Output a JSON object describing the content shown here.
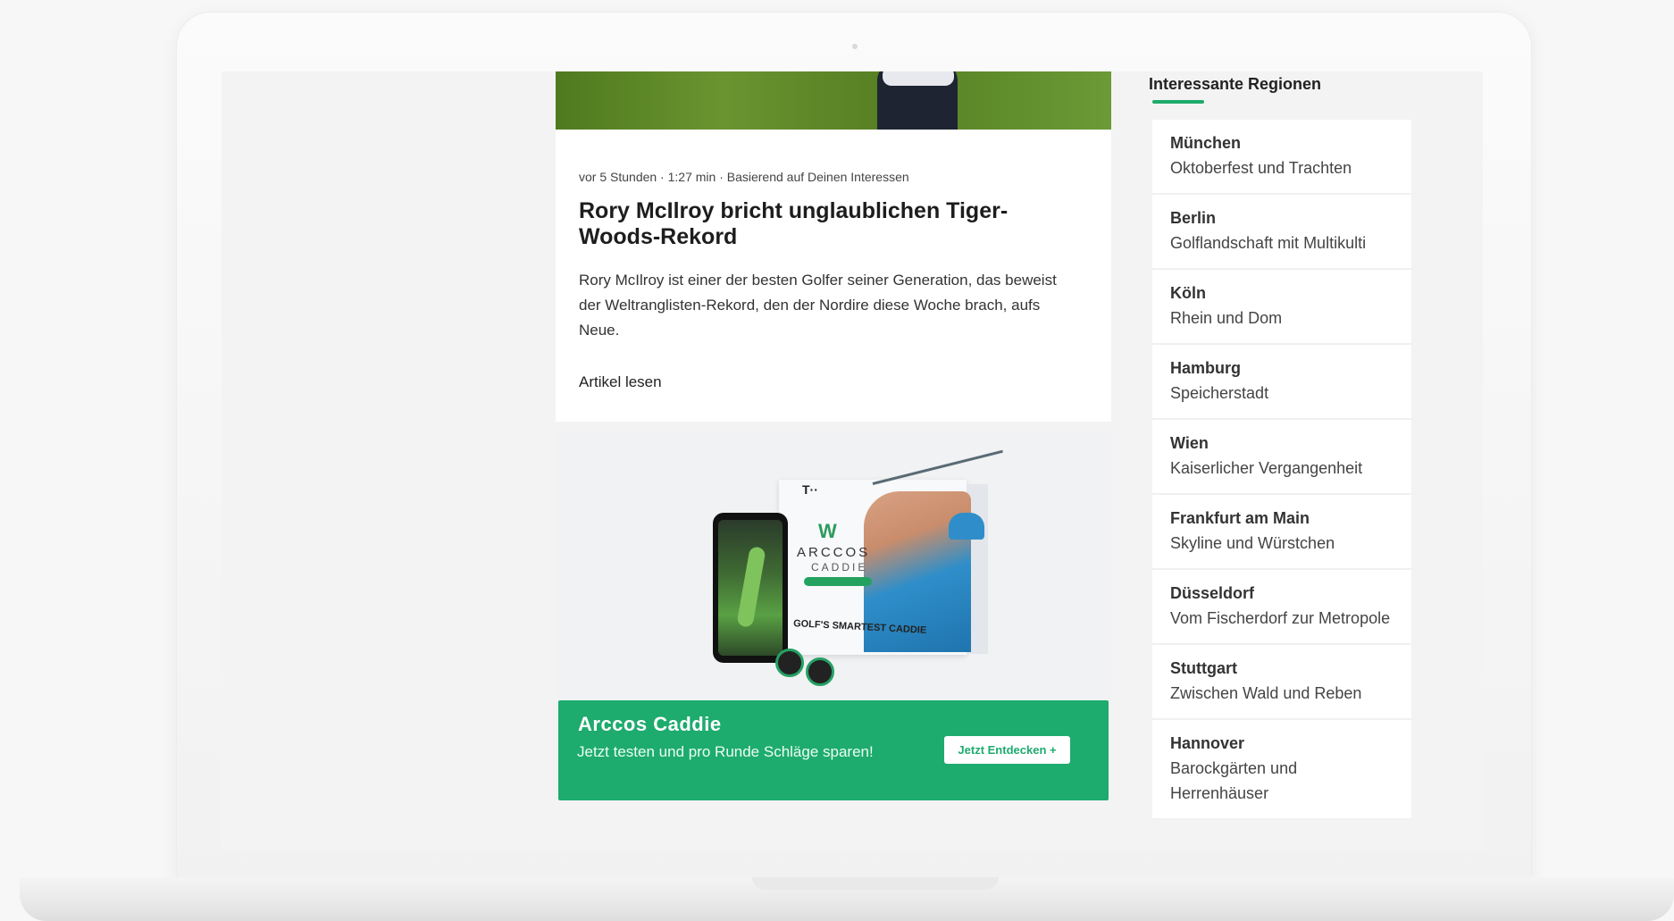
{
  "article": {
    "meta": "vor 5 Stunden · 1:27 min · Basierend auf Deinen Interessen",
    "headline": "Rory McIlroy bricht unglaublichen Tiger-Woods-Rekord",
    "excerpt": "Rory McIlroy ist einer der besten Golfer seiner Generation, das beweist der Weltranglisten-Rekord, den der Nordire diese Woche brach, aufs Neue.",
    "read_link": "Artikel lesen"
  },
  "ad": {
    "brand_name": "ARCCOS",
    "brand_sub": "CADDIE",
    "box_tagline": "GOLF'S SMARTEST CADDIE",
    "title": "Arccos Caddie",
    "text": "Jetzt testen und pro Runde Schläge sparen!",
    "cta": "Jetzt Entdecken +",
    "accent_color": "#1eab6e"
  },
  "sidebar": {
    "title": "Interessante Regionen",
    "regions": [
      {
        "name": "München",
        "desc": "Oktoberfest und Trachten"
      },
      {
        "name": "Berlin",
        "desc": "Golflandschaft mit Multikulti"
      },
      {
        "name": "Köln",
        "desc": "Rhein und Dom"
      },
      {
        "name": "Hamburg",
        "desc": "Speicherstadt"
      },
      {
        "name": "Wien",
        "desc": "Kaiserlicher Vergangenheit"
      },
      {
        "name": "Frankfurt am Main",
        "desc": "Skyline und Würstchen"
      },
      {
        "name": "Düsseldorf",
        "desc": "Vom Fischerdorf zur Metropole"
      },
      {
        "name": "Stuttgart",
        "desc": "Zwischen Wald und Reben"
      },
      {
        "name": "Hannover",
        "desc": "Barockgärten und Herrenhäuser"
      }
    ]
  }
}
